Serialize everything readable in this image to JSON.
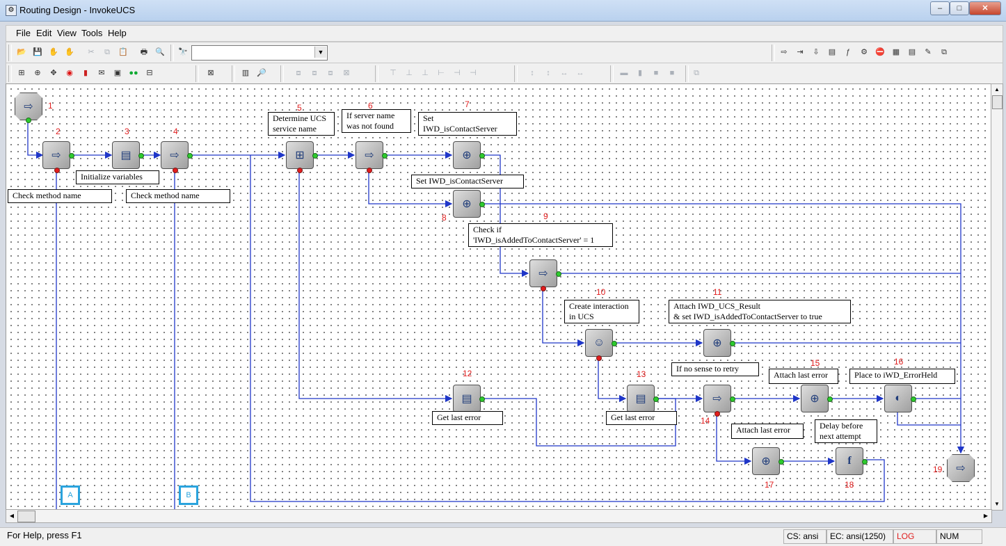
{
  "window": {
    "title": "Routing Design - InvokeUCS",
    "app_icon": "routing-app-icon",
    "minimize_glyph": "–",
    "maximize_glyph": "□",
    "close_glyph": "✕"
  },
  "menu": {
    "items": [
      "File",
      "Edit",
      "View",
      "Tools",
      "Help"
    ]
  },
  "toolbar": {
    "combo_value": "",
    "combo_arrow": "▼"
  },
  "diagram": {
    "nodes": [
      {
        "id": "1",
        "type": "entry",
        "icon": "entry-icon"
      },
      {
        "id": "2",
        "type": "branch",
        "icon": "branch-icon"
      },
      {
        "id": "3",
        "type": "assign",
        "icon": "assign-icon"
      },
      {
        "id": "4",
        "type": "branch",
        "icon": "branch-icon"
      },
      {
        "id": "5",
        "type": "multi-assign",
        "icon": "multi-assign-icon"
      },
      {
        "id": "6",
        "type": "branch",
        "icon": "branch-icon"
      },
      {
        "id": "7",
        "type": "attach",
        "icon": "attach-icon"
      },
      {
        "id": "8",
        "type": "attach",
        "icon": "attach-icon"
      },
      {
        "id": "9",
        "type": "branch",
        "icon": "branch-icon"
      },
      {
        "id": "10",
        "type": "create-interaction",
        "icon": "create-interaction-icon"
      },
      {
        "id": "11",
        "type": "attach",
        "icon": "attach-icon"
      },
      {
        "id": "12",
        "type": "assign",
        "icon": "assign-icon"
      },
      {
        "id": "13",
        "type": "assign",
        "icon": "assign-icon"
      },
      {
        "id": "14",
        "type": "branch",
        "icon": "branch-icon"
      },
      {
        "id": "15",
        "type": "attach",
        "icon": "attach-icon"
      },
      {
        "id": "16",
        "type": "place-in-queue",
        "icon": "queue-icon"
      },
      {
        "id": "17",
        "type": "attach",
        "icon": "attach-icon"
      },
      {
        "id": "18",
        "type": "function",
        "icon": "function-icon"
      },
      {
        "id": "19",
        "type": "exit",
        "icon": "exit-icon"
      }
    ],
    "labels": [
      "Check method name",
      "Initialize variables",
      "Check method name",
      "Determine UCS\nservice name",
      "If server name\nwas not found",
      "Set\nIWD_isContactServer",
      "Set IWD_isContactServer",
      "Check if\n'IWD_isAddedToContactServer' = 1",
      "Create interaction\nin UCS",
      "Attach IWD_UCS_Result\n& set IWD_isAddedToContactServer to true",
      "Get last error",
      "Get last error",
      "If no sense to retry",
      "Attach last error",
      "Place to iWD_ErrorHeld",
      "Attach last error",
      "Delay before\nnext attempt"
    ],
    "offpage_connectors": [
      "A",
      "B"
    ]
  },
  "status": {
    "help": "For Help, press F1",
    "cs": "CS: ansi",
    "ec": "EC: ansi(1250)",
    "log": "LOG",
    "num": "NUM"
  },
  "colors": {
    "connector": "#1f36c8",
    "node_number": "#e01d1d",
    "offpage_border": "#2aa3dd",
    "log_text": "#e01d1d"
  }
}
